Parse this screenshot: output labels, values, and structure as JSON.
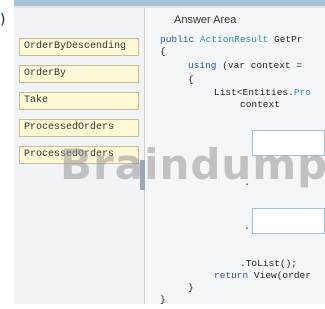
{
  "stray_char": ")",
  "source_items": [
    "OrderByDescending",
    "OrderBy",
    "Take",
    "ProcessedOrders",
    "ProcessedOrders"
  ],
  "answer_area": {
    "title": "Answer Area",
    "code": {
      "l1_kw": "public ",
      "l1_type": "ActionResult",
      "l1_rest": " GetPr",
      "l2": "{",
      "l3_kw": "using",
      "l3_rest": " (var context =",
      "l4": "{",
      "l5_kw": "List<Entities.",
      "l5_type": "Pro",
      "l6": "context",
      "dot1": ".",
      "dot2": ".",
      "l7": ".ToList();",
      "l8_kw": "return",
      "l8_rest": " View(order",
      "l9": "}",
      "l10": "}"
    }
  },
  "watermark": "Braindump"
}
